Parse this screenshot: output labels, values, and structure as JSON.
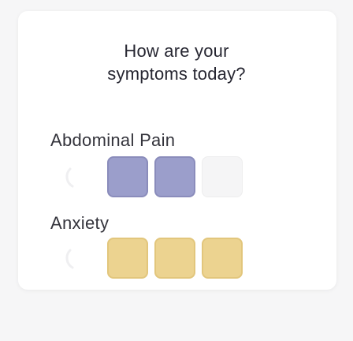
{
  "question": {
    "line1": "How are your",
    "line2": "symptoms today?"
  },
  "symptoms": [
    {
      "label": "Abdominal Pain",
      "severity": 2,
      "max_severity": 4,
      "color": "#9b9ecb"
    },
    {
      "label": "Anxiety",
      "severity": 3,
      "max_severity": 3,
      "color": "#ecd390"
    }
  ],
  "none_icon": "none-ring-icon"
}
